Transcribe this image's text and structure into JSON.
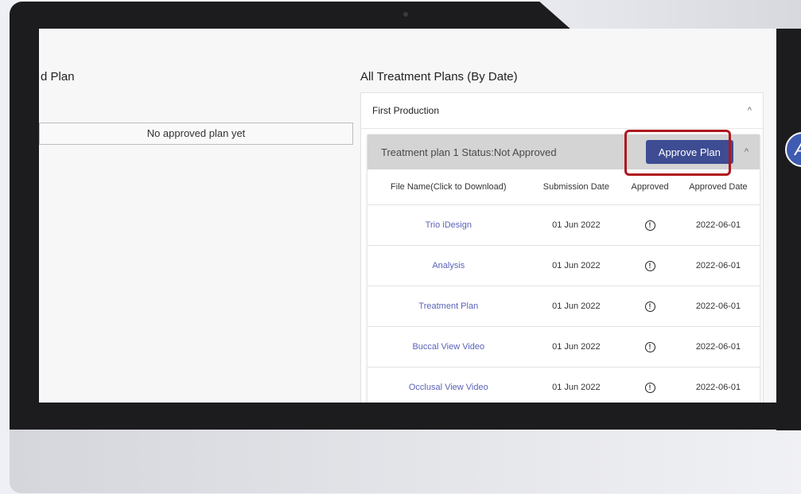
{
  "left": {
    "title": "d Plan",
    "no_plan_text": "No approved plan yet"
  },
  "right": {
    "title": "All Treatment Plans (By Date)",
    "group_label": "First Production",
    "plan": {
      "status_text": "Treatment plan 1 Status:Not Approved",
      "approve_label": "Approve Plan"
    },
    "columns": [
      "File Name(Click to Download)",
      "Submission Date",
      "Approved",
      "Approved Date"
    ],
    "rows": [
      {
        "file": "Trio iDesign",
        "submitted": "01 Jun 2022",
        "approved_icon": "!",
        "approved_date": "2022-06-01"
      },
      {
        "file": "Analysis",
        "submitted": "01 Jun 2022",
        "approved_icon": "!",
        "approved_date": "2022-06-01"
      },
      {
        "file": "Treatment Plan",
        "submitted": "01 Jun 2022",
        "approved_icon": "!",
        "approved_date": "2022-06-01"
      },
      {
        "file": "Buccal View Video",
        "submitted": "01 Jun 2022",
        "approved_icon": "!",
        "approved_date": "2022-06-01"
      },
      {
        "file": "Occlusal View Video",
        "submitted": "01 Jun 2022",
        "approved_icon": "!",
        "approved_date": "2022-06-01"
      }
    ]
  },
  "badge": {
    "letter": "A"
  },
  "icons": {
    "collapse": "^",
    "warning": "warning-icon"
  }
}
